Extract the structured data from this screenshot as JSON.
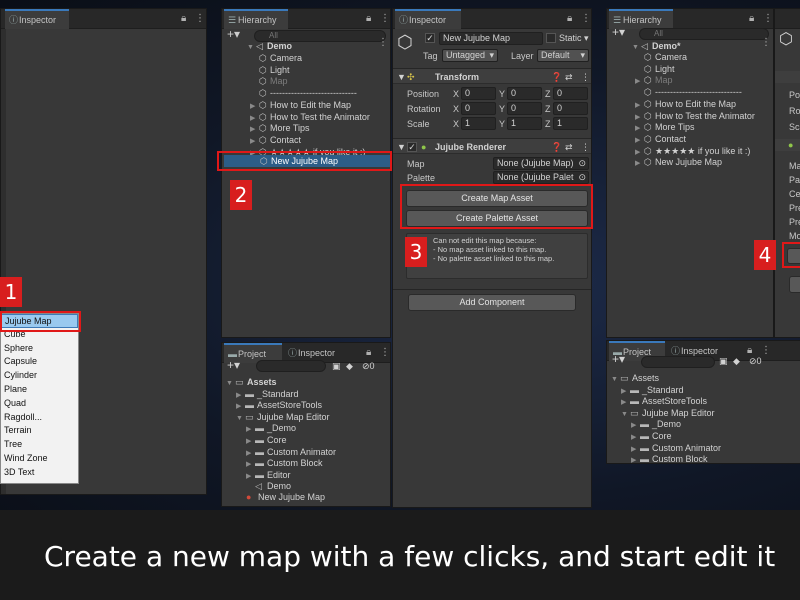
{
  "caption": "Create a new map with a few clicks, and start edit it",
  "steps": [
    "1",
    "2",
    "3",
    "4"
  ],
  "left_panel": {
    "tab": "Inspector",
    "context_menu": [
      "Jujube Map",
      "Cube",
      "Sphere",
      "Capsule",
      "Cylinder",
      "Plane",
      "Quad",
      "Ragdoll...",
      "Terrain",
      "Tree",
      "Wind Zone",
      "3D Text"
    ]
  },
  "hierarchy": {
    "tab": "Hierarchy",
    "search_placeholder": "All",
    "root": "Demo",
    "items": [
      {
        "label": "Camera",
        "arrow": false,
        "dim": false
      },
      {
        "label": "Light",
        "arrow": false,
        "dim": false
      },
      {
        "label": "Map",
        "arrow": false,
        "dim": true
      },
      {
        "label": "-----------------------------",
        "arrow": false,
        "dim": false
      },
      {
        "label": "How to Edit the Map",
        "arrow": true,
        "dim": false
      },
      {
        "label": "How to Test the Animator",
        "arrow": true,
        "dim": false
      },
      {
        "label": "More Tips",
        "arrow": true,
        "dim": false
      },
      {
        "label": "Contact",
        "arrow": true,
        "dim": false
      },
      {
        "label": "★★★★★ if you like it :)",
        "arrow": true,
        "dim": false
      }
    ],
    "new_item": "New Jujube Map"
  },
  "project": {
    "tabs": [
      "Project",
      "Inspector"
    ],
    "hidden_count": "0",
    "tree": [
      {
        "label": "Assets",
        "depth": 0,
        "open": true,
        "bold": true
      },
      {
        "label": "_Standard",
        "depth": 1,
        "open": false
      },
      {
        "label": "AssetStoreTools",
        "depth": 1,
        "open": false
      },
      {
        "label": "Jujube Map Editor",
        "depth": 1,
        "open": true
      },
      {
        "label": "_Demo",
        "depth": 2,
        "open": false
      },
      {
        "label": "Core",
        "depth": 2,
        "open": false
      },
      {
        "label": "Custom Animator",
        "depth": 2,
        "open": false
      },
      {
        "label": "Custom Block",
        "depth": 2,
        "open": false
      },
      {
        "label": "Editor",
        "depth": 2,
        "open": false
      },
      {
        "label": "Demo",
        "depth": 2,
        "scene": true
      }
    ],
    "new_asset": "New Jujube Map"
  },
  "inspector": {
    "tab": "Inspector",
    "object_name": "New Jujube Map",
    "static_label": "Static",
    "tag_label": "Tag",
    "tag_value": "Untagged",
    "layer_label": "Layer",
    "layer_value": "Default",
    "transform": {
      "title": "Transform",
      "rows": [
        {
          "label": "Position",
          "x": "0",
          "y": "0",
          "z": "0"
        },
        {
          "label": "Rotation",
          "x": "0",
          "y": "0",
          "z": "0"
        },
        {
          "label": "Scale",
          "x": "1",
          "y": "1",
          "z": "1"
        }
      ],
      "axes": [
        "X",
        "Y",
        "Z"
      ]
    },
    "renderer": {
      "title": "Jujube Renderer",
      "map_label": "Map",
      "map_value": "None (Jujube Map)",
      "palette_label": "Palette",
      "palette_value": "None (Jujube Palet",
      "create_map_button": "Create Map Asset",
      "create_palette_button": "Create Palette Asset",
      "warning_lines": [
        "Can not edit this map because:",
        " - No map asset linked to this map.",
        " - No palette asset linked to this map."
      ]
    },
    "add_component": "Add Component"
  },
  "right_panel": {
    "hierarchy_tab": "Hierarchy",
    "search_placeholder": "All",
    "root": "Demo*",
    "items": [
      {
        "label": "Camera",
        "arrow": false,
        "dim": false
      },
      {
        "label": "Light",
        "arrow": false,
        "dim": false
      },
      {
        "label": "Map",
        "arrow": true,
        "dim": true
      },
      {
        "label": "-----------------------------",
        "arrow": false,
        "dim": false
      },
      {
        "label": "How to Edit the Map",
        "arrow": true,
        "dim": false
      },
      {
        "label": "How to Test the Animator",
        "arrow": true,
        "dim": false
      },
      {
        "label": "More Tips",
        "arrow": true,
        "dim": false
      },
      {
        "label": "Contact",
        "arrow": true,
        "dim": false
      },
      {
        "label": "★★★★★ if you like it :)",
        "arrow": true,
        "dim": false
      },
      {
        "label": "New Jujube Map",
        "arrow": true,
        "dim": false
      }
    ],
    "inspector_fragments": [
      "Po",
      "Ro",
      "Sca",
      "Ma",
      "Pal",
      "Cel",
      "Pre",
      "Pre",
      "Mo"
    ],
    "project_tabs": [
      "Project",
      "Inspector"
    ],
    "hidden_count": "0",
    "tree": [
      {
        "label": "Assets",
        "depth": 0,
        "open": true
      },
      {
        "label": "_Standard",
        "depth": 1,
        "open": false
      },
      {
        "label": "AssetStoreTools",
        "depth": 1,
        "open": false
      },
      {
        "label": "Jujube Map Editor",
        "depth": 1,
        "open": true
      },
      {
        "label": "_Demo",
        "depth": 2,
        "open": false
      },
      {
        "label": "Core",
        "depth": 2,
        "open": false
      },
      {
        "label": "Custom Animator",
        "depth": 2,
        "open": false
      },
      {
        "label": "Custom Block",
        "depth": 2,
        "open": false
      }
    ]
  }
}
